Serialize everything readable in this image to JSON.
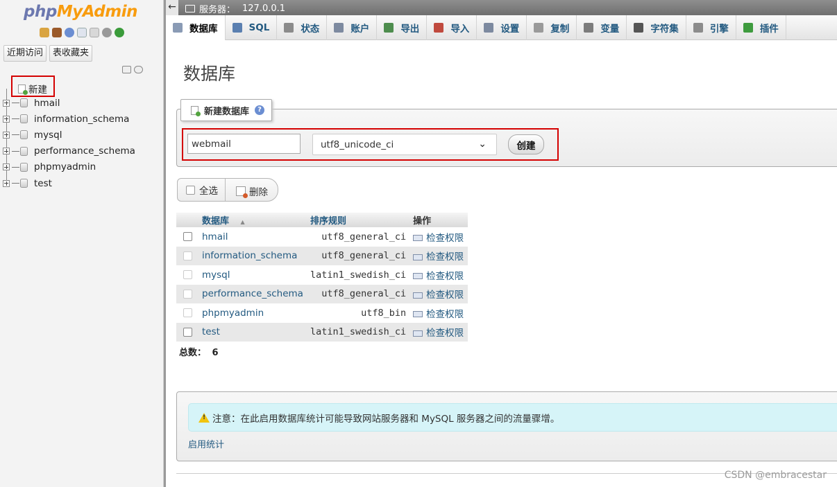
{
  "sidebar": {
    "logo_php": "php",
    "logo_myadmin": "MyAdmin",
    "recent_btn": "近期访问",
    "favorites_btn": "表收藏夹",
    "new_label": "新建",
    "databases": [
      "hmail",
      "information_schema",
      "mysql",
      "performance_schema",
      "phpmyadmin",
      "test"
    ]
  },
  "serverbar": {
    "label": "服务器：",
    "host": "127.0.0.1"
  },
  "menubar": {
    "tabs": [
      {
        "label": "数据库",
        "icon": "database-icon",
        "color": "#8a9bb5"
      },
      {
        "label": "SQL",
        "icon": "sql-icon",
        "color": "#5a7fb0"
      },
      {
        "label": "状态",
        "icon": "status-icon",
        "color": "#8b8b8b"
      },
      {
        "label": "账户",
        "icon": "accounts-icon",
        "color": "#7d8aa0"
      },
      {
        "label": "导出",
        "icon": "export-icon",
        "color": "#4e8d4e"
      },
      {
        "label": "导入",
        "icon": "import-icon",
        "color": "#c04a3e"
      },
      {
        "label": "设置",
        "icon": "settings-icon",
        "color": "#7d8aa0"
      },
      {
        "label": "复制",
        "icon": "replication-icon",
        "color": "#9a9a9a"
      },
      {
        "label": "变量",
        "icon": "variables-icon",
        "color": "#7c7c7c"
      },
      {
        "label": "字符集",
        "icon": "charset-icon",
        "color": "#555555"
      },
      {
        "label": "引擎",
        "icon": "engines-icon",
        "color": "#8c8c8c"
      },
      {
        "label": "插件",
        "icon": "plugins-icon",
        "color": "#3e9b3e"
      }
    ]
  },
  "main": {
    "title": "数据库",
    "create_legend": "新建数据库",
    "db_name_value": "webmail",
    "collation_value": "utf8_unicode_ci",
    "create_btn": "创建",
    "select_all": "全选",
    "delete_btn": "删除",
    "table": {
      "headers": {
        "db": "数据库",
        "collation": "排序规则",
        "action": "操作"
      },
      "sort_indicator": "▲",
      "rows": [
        {
          "name": "hmail",
          "collation": "utf8_general_ci",
          "action": "检查权限"
        },
        {
          "name": "information_schema",
          "collation": "utf8_general_ci",
          "action": "检查权限"
        },
        {
          "name": "mysql",
          "collation": "latin1_swedish_ci",
          "action": "检查权限"
        },
        {
          "name": "performance_schema",
          "collation": "utf8_general_ci",
          "action": "检查权限"
        },
        {
          "name": "phpmyadmin",
          "collation": "utf8_bin",
          "action": "检查权限"
        },
        {
          "name": "test",
          "collation": "latin1_swedish_ci",
          "action": "检查权限"
        }
      ]
    },
    "total_label": "总数：",
    "total_value": "6",
    "notice": "注意：在此启用数据库统计可能导致网站服务器和 MySQL 服务器之间的流量骤增。",
    "enable_stats": "启用统计"
  },
  "watermark": "CSDN @embracestar"
}
